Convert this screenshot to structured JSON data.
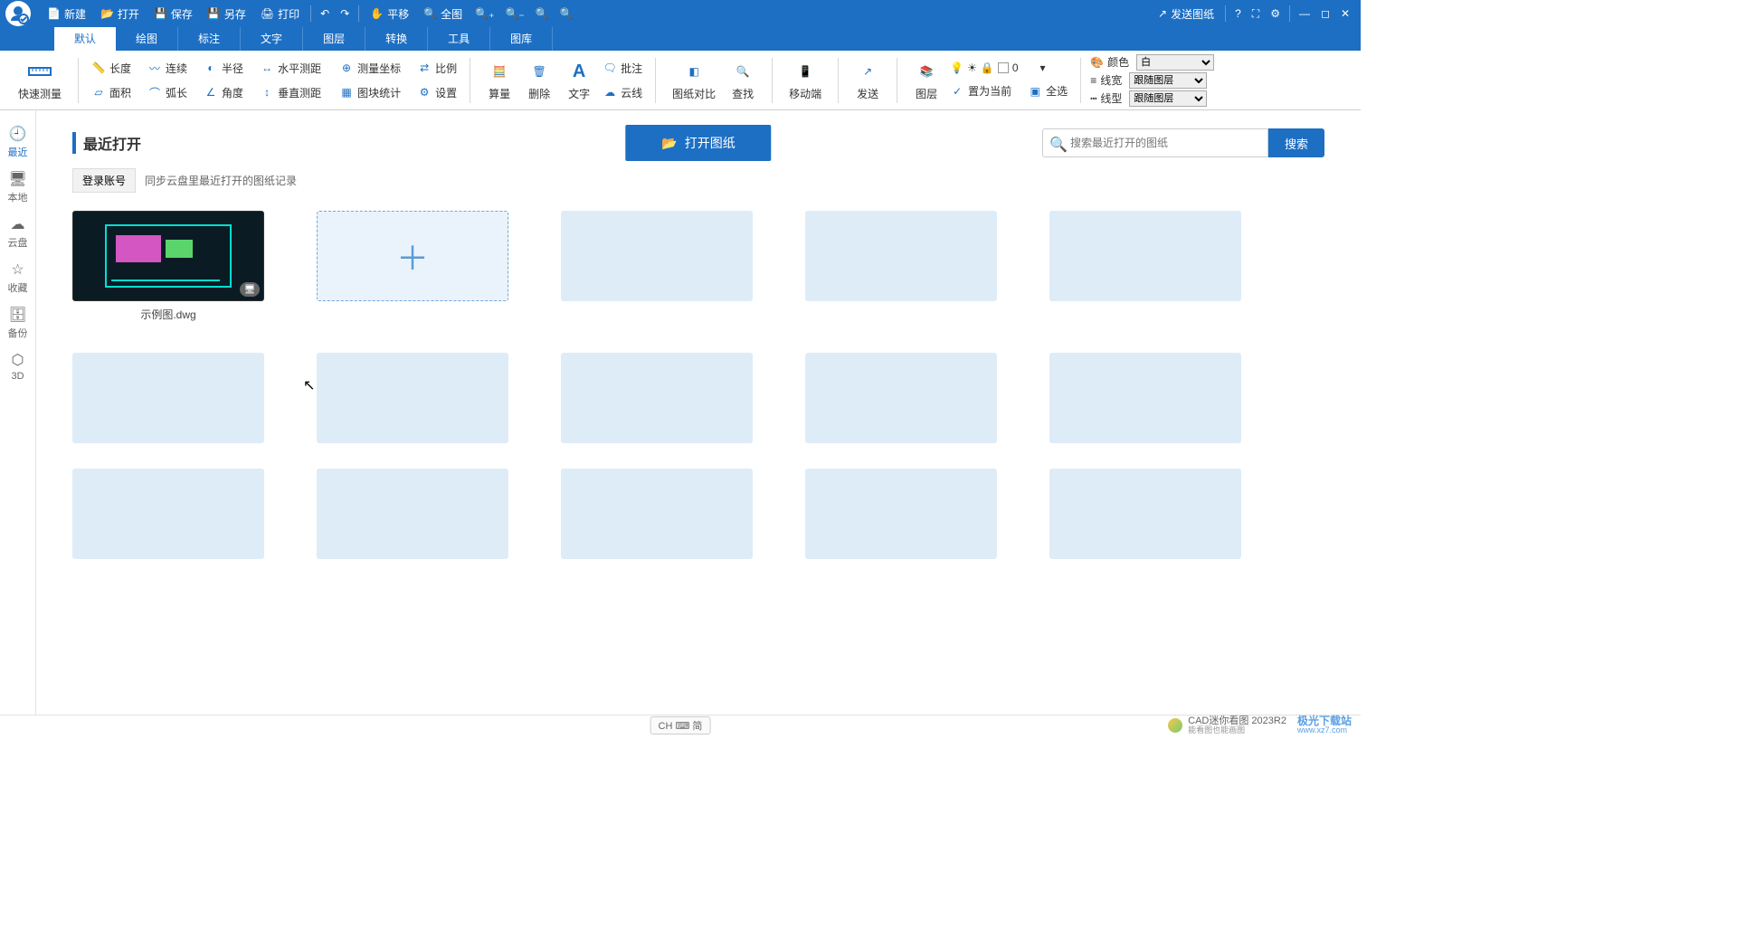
{
  "titlebar": {
    "new": "新建",
    "open": "打开",
    "save": "保存",
    "saveas": "另存",
    "print": "打印",
    "pan": "平移",
    "full": "全图",
    "send": "发送图纸"
  },
  "tabs": {
    "default": "默认",
    "draw": "绘图",
    "annotate": "标注",
    "text": "文字",
    "layer": "图层",
    "convert": "转换",
    "tool": "工具",
    "library": "图库"
  },
  "ribbon": {
    "quick_measure": "快速测量",
    "length": "长度",
    "continuous": "连续",
    "radius": "半径",
    "hdist": "水平测距",
    "area": "面积",
    "arc": "弧长",
    "angle": "角度",
    "vdist": "垂直测距",
    "coord": "测量坐标",
    "ratio": "比例",
    "block_stat": "图块统计",
    "settings": "设置",
    "calc": "算量",
    "delete": "删除",
    "textbtn": "文字",
    "batch": "批注",
    "cloudline": "云线",
    "compare": "图纸对比",
    "find": "查找",
    "mobile": "移动端",
    "sendbtn": "发送",
    "layerbtn": "图层",
    "set_current": "置为当前",
    "select_all": "全选",
    "color": "颜色",
    "color_val": "白",
    "linewidth": "线宽",
    "linewidth_val": "跟随图层",
    "linetype": "线型",
    "linetype_val": "跟随图层",
    "zero": "0"
  },
  "sidebar": {
    "recent": "最近",
    "local": "本地",
    "cloud": "云盘",
    "fav": "收藏",
    "backup": "备份",
    "three_d": "3D"
  },
  "content": {
    "section_title": "最近打开",
    "open_drawing": "打开图纸",
    "search_placeholder": "搜索最近打开的图纸",
    "search_btn": "搜索",
    "login": "登录账号",
    "sync_hint": "同步云盘里最近打开的图纸记录",
    "file1": "示例图.dwg"
  },
  "status": {
    "ime": "CH ⌨ 简",
    "app_version": "CAD迷你看图 2023R2",
    "tagline": "能看图也能画图",
    "site": "www.xz7.com",
    "watermark": "极光下载站"
  }
}
